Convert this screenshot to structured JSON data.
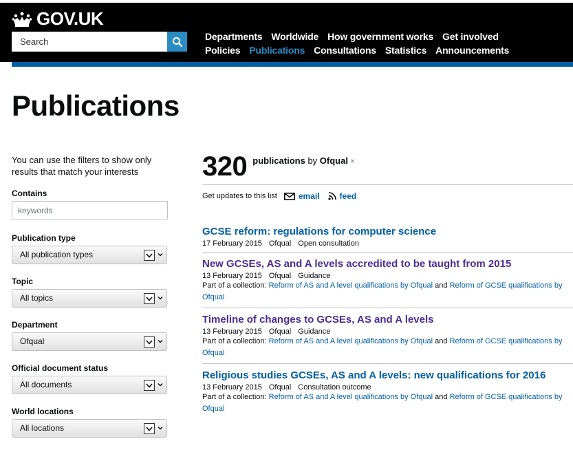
{
  "header": {
    "logo_text": "GOV.UK",
    "search_placeholder": "Search",
    "nav_row1": [
      "Departments",
      "Worldwide",
      "How government works",
      "Get involved"
    ],
    "nav_row2": [
      "Policies",
      "Publications",
      "Consultations",
      "Statistics",
      "Announcements"
    ],
    "active_nav": "Publications"
  },
  "page_title": "Publications",
  "sidebar": {
    "intro": "You can use the filters to show only results that match your interests",
    "contains_label": "Contains",
    "contains_placeholder": "keywords",
    "filters": [
      {
        "label": "Publication type",
        "value": "All publication types"
      },
      {
        "label": "Topic",
        "value": "All topics"
      },
      {
        "label": "Department",
        "value": "Ofqual"
      },
      {
        "label": "Official document status",
        "value": "All documents"
      },
      {
        "label": "World locations",
        "value": "All locations"
      }
    ]
  },
  "main": {
    "count": "320",
    "count_text": "publications",
    "by_text": "by",
    "filter_org": "Ofqual",
    "remove_symbol": "×",
    "updates_label": "Get updates to this list",
    "email_label": "email",
    "feed_label": "feed",
    "collection_prefix": "Part of a collection:",
    "and_text": "and",
    "results": [
      {
        "title": "GCSE reform: regulations for computer science",
        "date": "17 February 2015",
        "org": "Ofqual",
        "type": "Open consultation",
        "collections": [],
        "visited": false
      },
      {
        "title": "New GCSEs, AS and A levels accredited to be taught from 2015",
        "date": "13 February 2015",
        "org": "Ofqual",
        "type": "Guidance",
        "collections": [
          "Reform of AS and A level qualifications by Ofqual",
          "Reform of GCSE qualifications by Ofqual"
        ],
        "visited": true
      },
      {
        "title": "Timeline of changes to GCSEs, AS and A levels",
        "date": "13 February 2015",
        "org": "Ofqual",
        "type": "Guidance",
        "collections": [
          "Reform of AS and A level qualifications by Ofqual",
          "Reform of GCSE qualifications by Ofqual"
        ],
        "visited": true
      },
      {
        "title": "Religious studies GCSEs, AS and A levels: new qualifications for 2016",
        "date": "13 February 2015",
        "org": "Ofqual",
        "type": "Consultation outcome",
        "collections": [
          "Reform of AS and A level qualifications by Ofqual",
          "Reform of GCSE qualifications by Ofqual"
        ],
        "visited": false
      }
    ]
  },
  "colors": {
    "link": "#005ea5",
    "visited": "#4c2c92",
    "header": "#000000",
    "accent": "#2b8cc4"
  }
}
